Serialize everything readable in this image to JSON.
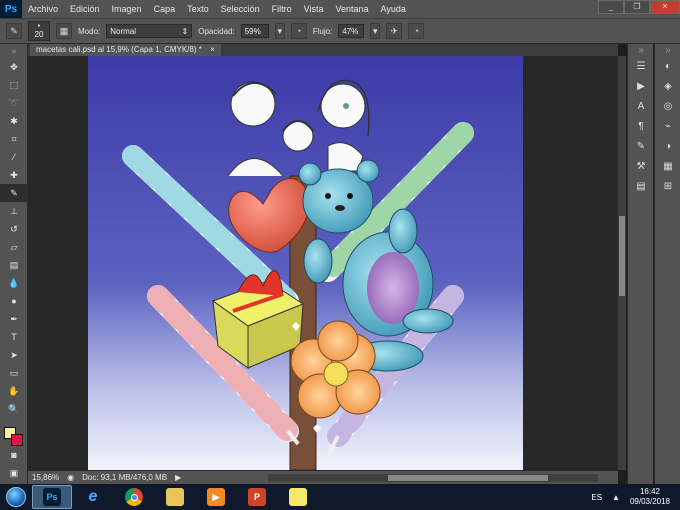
{
  "app": {
    "logo": "Ps"
  },
  "menu": [
    "Archivo",
    "Edición",
    "Imagen",
    "Capa",
    "Texto",
    "Selección",
    "Filtro",
    "Vista",
    "Ventana",
    "Ayuda"
  ],
  "window_controls": {
    "minimize": "_",
    "restore": "❐",
    "close": "✕"
  },
  "options": {
    "brush_size": "20",
    "mode_label": "Modo:",
    "mode_value": "Normal",
    "opacity_label": "Opacidad:",
    "opacity_value": "59%",
    "flow_label": "Flujo:",
    "flow_value": "47%"
  },
  "document": {
    "tab_title": "macetas cali.psd al 15,9% (Capa 1, CMYK/8) *",
    "tab_close": "×"
  },
  "status": {
    "zoom": "15,86%",
    "doc_info": "Doc: 93,1 MB/476,0 MB"
  },
  "colors": {
    "foreground": "#f7f0a0",
    "background": "#e8113f"
  },
  "taskbar": {
    "apps": [
      "photoshop-icon",
      "internet-explorer-icon",
      "chrome-icon",
      "file-explorer-icon",
      "media-player-icon",
      "powerpoint-icon",
      "sticky-notes-icon"
    ],
    "lang": "ES",
    "time": "16:42",
    "date": "09/03/2018"
  }
}
